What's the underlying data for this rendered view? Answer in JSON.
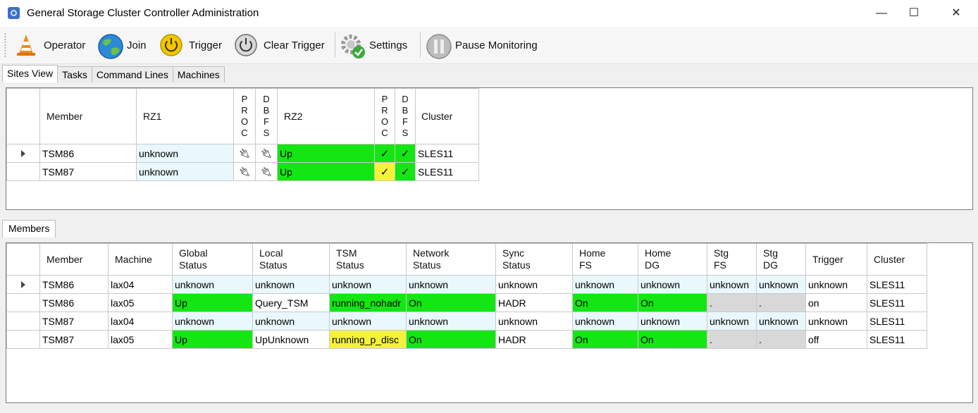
{
  "window": {
    "title": "General Storage Cluster Controller Administration",
    "minimize": "—",
    "maximize": "☐",
    "close": "✕"
  },
  "toolbar": {
    "operator": "Operator",
    "join": "Join",
    "trigger": "Trigger",
    "clear_trigger": "Clear Trigger",
    "settings": "Settings",
    "pause_monitoring": "Pause Monitoring"
  },
  "tabs": [
    "Sites View",
    "Tasks",
    "Command Lines",
    "Machines"
  ],
  "sites_table": {
    "headers": {
      "member": "Member",
      "rz1": "RZ1",
      "proc": "P\nR\nO\nC",
      "dbfs": "D\nB\nF\nS",
      "rz2": "RZ2",
      "proc2": "P\nR\nO\nC",
      "dbfs2": "D\nB\nF\nS",
      "cluster": "Cluster"
    },
    "rows": [
      {
        "member": "TSM86",
        "rz1": "unknown",
        "proc1": "plug-icon",
        "dbfs1": "plug-icon",
        "rz2": "Up",
        "proc2": "✓",
        "dbfs2": "✓",
        "cluster": "SLES11"
      },
      {
        "member": "TSM87",
        "rz1": "unknown",
        "proc1": "plug-icon",
        "dbfs1": "plug-icon",
        "rz2": "Up",
        "proc2": "✓",
        "dbfs2": "✓",
        "cluster": "SLES11"
      }
    ]
  },
  "members_tab": "Members",
  "members_table": {
    "headers": [
      "Member",
      "Machine",
      "Global\nStatus",
      "Local\nStatus",
      "TSM\nStatus",
      "Network\nStatus",
      "Sync\nStatus",
      "Home\nFS",
      "Home\nDG",
      "Stg\nFS",
      "Stg\nDG",
      "Trigger",
      "Cluster"
    ],
    "rows": [
      [
        "TSM86",
        "lax04",
        "unknown",
        "unknown",
        "unknown",
        "unknown",
        "unknown",
        "unknown",
        "unknown",
        "unknown",
        "unknown",
        "unknown",
        "SLES11"
      ],
      [
        "TSM86",
        "lax05",
        "Up",
        "Query_TSM",
        "running_nohadr",
        "On",
        "HADR",
        "On",
        "On",
        ".",
        ".",
        "on",
        "SLES11"
      ],
      [
        "TSM87",
        "lax04",
        "unknown",
        "unknown",
        "unknown",
        "unknown",
        "unknown",
        "unknown",
        "unknown",
        "unknown",
        "unknown",
        "unknown",
        "SLES11"
      ],
      [
        "TSM87",
        "lax05",
        "Up",
        "UpUnknown",
        "running_p_disc",
        "On",
        "HADR",
        "On",
        "On",
        ".",
        ".",
        "off",
        "SLES11"
      ]
    ]
  },
  "colors": {
    "up": "#14e614",
    "unknown": "#e8f8fc",
    "warn": "#f5f23a",
    "na": "#d8d8d8"
  }
}
